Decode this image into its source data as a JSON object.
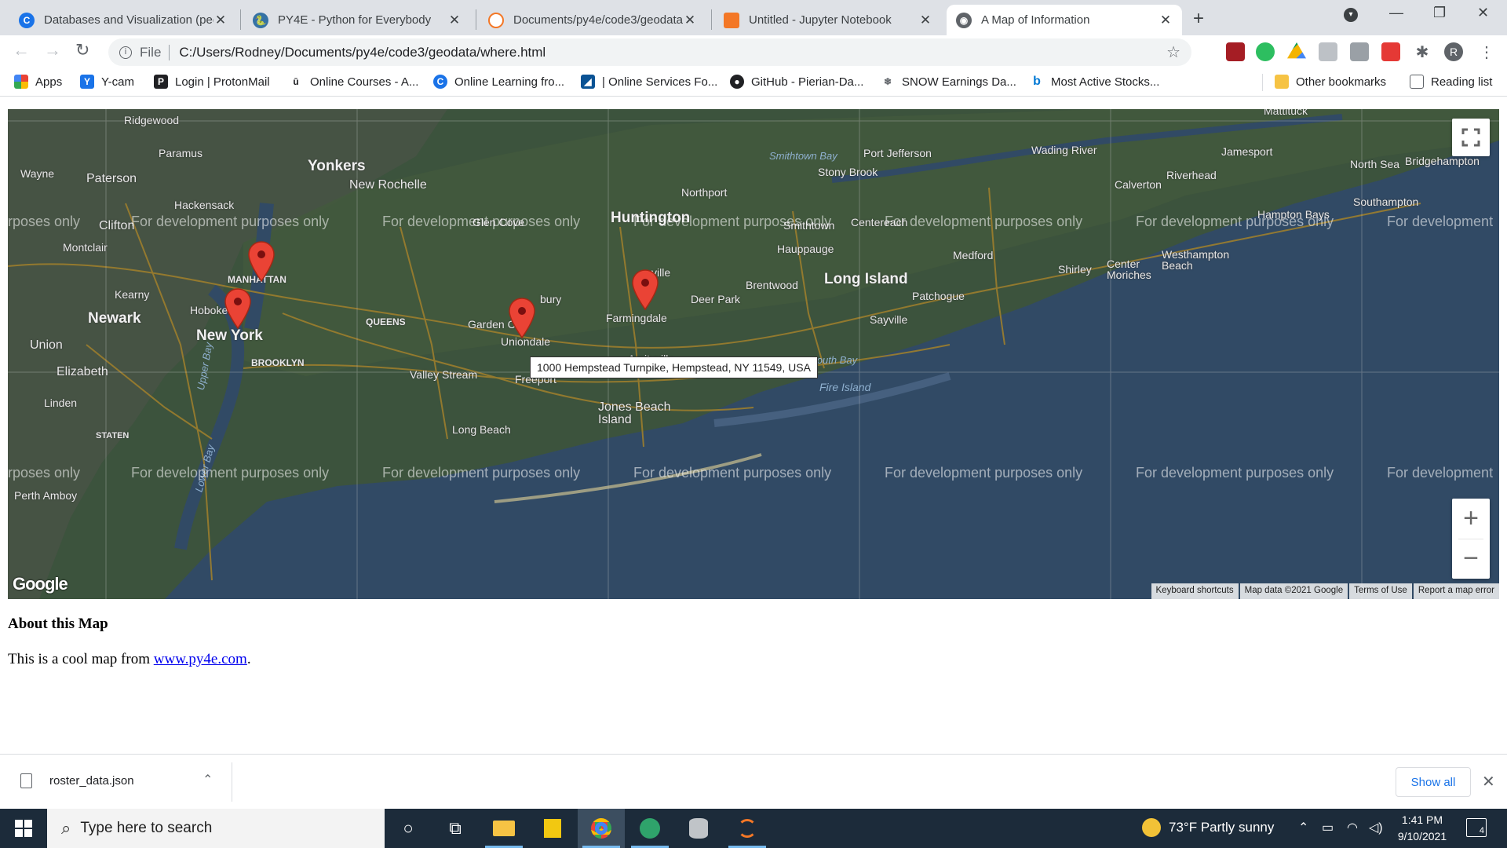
{
  "tabs": [
    {
      "label": "Databases and Visualization (pee",
      "icon": "coursera-icon",
      "color": "#1a73e8"
    },
    {
      "label": "PY4E - Python for Everybody",
      "icon": "python-icon",
      "color": "#3572a5"
    },
    {
      "label": "Documents/py4e/code3/geodata",
      "icon": "jupyter-icon",
      "color": "#f37726"
    },
    {
      "label": "Untitled - Jupyter Notebook",
      "icon": "notebook-icon",
      "color": "#f37726"
    },
    {
      "label": "A Map of Information",
      "icon": "globe-icon",
      "color": "#5f6368"
    }
  ],
  "address": {
    "scheme": "File",
    "url": "C:/Users/Rodney/Documents/py4e/code3/geodata/where.html"
  },
  "bookmarks": [
    {
      "label": "Apps"
    },
    {
      "label": "Y-cam"
    },
    {
      "label": "Login | ProtonMail"
    },
    {
      "label": "Online Courses - A..."
    },
    {
      "label": "Online Learning fro..."
    },
    {
      "label": "| Online Services Fo..."
    },
    {
      "label": "GitHub - Pierian-Da..."
    },
    {
      "label": "SNOW Earnings Da..."
    },
    {
      "label": "Most Active Stocks..."
    }
  ],
  "bookmarks_right": {
    "other": "Other bookmarks",
    "reading": "Reading list"
  },
  "profile_initial": "R",
  "map": {
    "watermark": "For development purposes only",
    "watermark_left": "rposes only",
    "watermark_right": "For development",
    "tooltip": "1000 Hempstead Turnpike, Hempstead, NY 11549, USA",
    "logo": "Google",
    "attribution": [
      "Keyboard shortcuts",
      "Map data ©2021 Google",
      "Terms of Use",
      "Report a map error"
    ],
    "places": {
      "ridgewood": "Ridgewood",
      "paramus": "Paramus",
      "wayne": "Wayne",
      "paterson": "Paterson",
      "yonkers": "Yonkers",
      "new_rochelle": "New Rochelle",
      "hackensack": "Hackensack",
      "clifton": "Clifton",
      "montclair": "Montclair",
      "glen_cove": "Glen Cove",
      "huntington": "Huntington",
      "northport": "Northport",
      "smithtown": "Smithtown",
      "smithtown_bay": "Smithtown Bay",
      "port_jefferson": "Port Jefferson",
      "stony_brook": "Stony Brook",
      "centereach": "Centereach",
      "hauppauge": "Hauppauge",
      "wading_river": "Wading River",
      "jamesport": "Jamesport",
      "riverhead": "Riverhead",
      "calverton": "Calverton",
      "north_sea": "North Sea",
      "bridgehampton": "Bridgehampton",
      "southampton": "Southampton",
      "hampton_bays": "Hampton Bays",
      "westhampton_beach": "Westhampton Beach",
      "medford": "Medford",
      "shirley": "Shirley",
      "center_moriches": "Center Moriches",
      "long_island": "Long Island",
      "patchogue": "Patchogue",
      "brentwood": "Brentwood",
      "deer_park": "Deer Park",
      "sayville": "Sayville",
      "manhattan": "MANHATTAN",
      "kearny": "Kearny",
      "hoboken": "Hoboken",
      "newark": "Newark",
      "new_york": "New York",
      "queens": "QUEENS",
      "union": "Union",
      "brooklyn": "BROOKLYN",
      "elizabeth": "Elizabeth",
      "valley_stream": "Valley Stream",
      "garden_city": "Garden C",
      "uniondale": "Uniondale",
      "freeport": "Freeport",
      "amityville": "Amityville",
      "farmingdale": "Farmingdale",
      "great_south_bay": "Great South Bay",
      "fire_island": "Fire Island",
      "linden": "Linden",
      "jones_beach": "Jones Beach Island",
      "long_beach": "Long Beach",
      "staten": "STATEN",
      "perth_amboy": "Perth Amboy",
      "mattituck": "Mattituck",
      "upper_bay": "Upper Bay",
      "lower_bay": "Lower Bay",
      "ville": "ville",
      "bury": "bury"
    }
  },
  "about": {
    "title": "About this Map",
    "text_before": "This is a cool map from ",
    "link": "www.py4e.com",
    "text_after": "."
  },
  "download": {
    "filename": "roster_data.json",
    "show_all": "Show all"
  },
  "taskbar": {
    "search_placeholder": "Type here to search",
    "weather": "73°F  Partly sunny",
    "time": "1:41 PM",
    "date": "9/10/2021",
    "notifications": "4"
  }
}
